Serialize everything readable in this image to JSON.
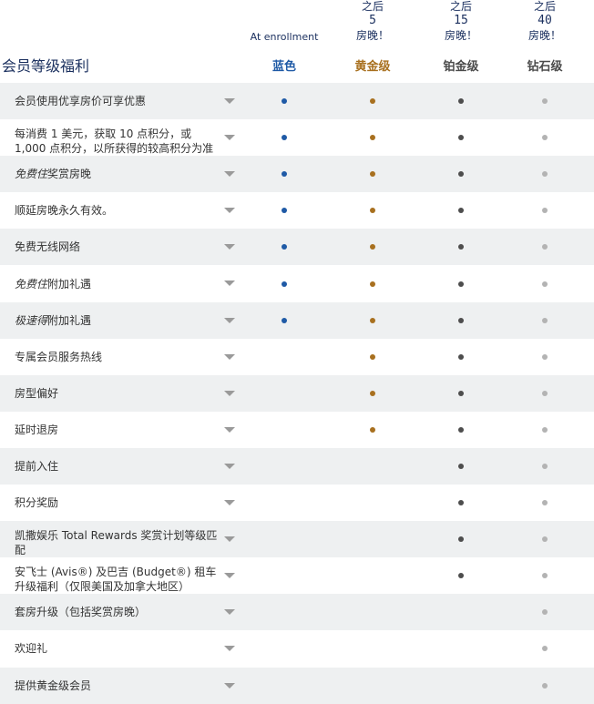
{
  "header": {
    "table_title": "会员等级福利",
    "tiers": [
      {
        "key": "blue",
        "enroll_label": "At enrollment",
        "after": "",
        "nights": "",
        "nights_label": "",
        "name": "蓝色",
        "color": "#1f5aa6"
      },
      {
        "key": "gold",
        "enroll_label": "",
        "after": "之后",
        "nights": "5",
        "nights_label": "房晚！",
        "name": "黄金级",
        "color": "#a8701f"
      },
      {
        "key": "platinum",
        "enroll_label": "",
        "after": "之后",
        "nights": "15",
        "nights_label": "房晚！",
        "name": "铂金级",
        "color": "#4a4a4a"
      },
      {
        "key": "diamond",
        "enroll_label": "",
        "after": "之后",
        "nights": "40",
        "nights_label": "房晚！",
        "name": "钻石级",
        "color": "#4a4a4a"
      }
    ]
  },
  "dot_colors": [
    "#1f5aa6",
    "#a8701f",
    "#4d4d4d",
    "#b3b3b3"
  ],
  "benefits": [
    {
      "label": "会员使用优享房价可享优惠",
      "tiers": [
        1,
        1,
        1,
        1
      ]
    },
    {
      "label": "每消费 1 美元，获取 10 点积分，或 1,000 点积分，以所获得的较高积分为准",
      "tiers": [
        1,
        1,
        1,
        1
      ]
    },
    {
      "label_italic": "免费住",
      "label_rest": "奖赏房晚",
      "tiers": [
        1,
        1,
        1,
        1
      ]
    },
    {
      "label": "顺延房晚永久有效。",
      "tiers": [
        1,
        1,
        1,
        1
      ]
    },
    {
      "label": "免费无线网络",
      "tiers": [
        1,
        1,
        1,
        1
      ]
    },
    {
      "label_italic": "免费住",
      "label_rest": "附加礼遇",
      "tiers": [
        1,
        1,
        1,
        1
      ]
    },
    {
      "label_italic": "极速得",
      "label_rest": "附加礼遇",
      "tiers": [
        1,
        1,
        1,
        1
      ]
    },
    {
      "label": "专属会员服务热线",
      "tiers": [
        0,
        1,
        1,
        1
      ]
    },
    {
      "label": "房型偏好",
      "tiers": [
        0,
        1,
        1,
        1
      ]
    },
    {
      "label": "延时退房",
      "tiers": [
        0,
        1,
        1,
        1
      ]
    },
    {
      "label": "提前入住",
      "tiers": [
        0,
        0,
        1,
        1
      ]
    },
    {
      "label": "积分奖励",
      "tiers": [
        0,
        0,
        1,
        1
      ]
    },
    {
      "label": "凯撒娱乐 Total Rewards 奖赏计划等级匹配",
      "tiers": [
        0,
        0,
        1,
        1
      ]
    },
    {
      "label": "安飞士 (Avis®) 及巴吉 (Budget®) 租车升级福利（仅限美国及加拿大地区）",
      "tiers": [
        0,
        0,
        1,
        1
      ]
    },
    {
      "label": "套房升级（包括奖赏房晚）",
      "tiers": [
        0,
        0,
        0,
        1
      ]
    },
    {
      "label": "欢迎礼",
      "tiers": [
        0,
        0,
        0,
        1
      ]
    },
    {
      "label": "提供黄金级会员",
      "tiers": [
        0,
        0,
        0,
        1
      ]
    }
  ]
}
